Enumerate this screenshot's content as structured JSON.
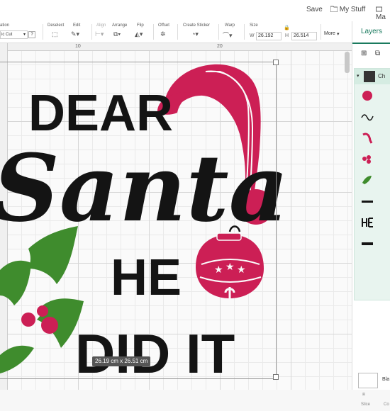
{
  "topbar": {
    "save": "Save",
    "my_stuff": "My Stuff",
    "ma": "Ma"
  },
  "toolbar": {
    "operation_label": "ation",
    "operation_value": "ic Cut",
    "deselect": "Deselect",
    "edit": "Edit",
    "align": "Align",
    "arrange": "Arrange",
    "flip": "Flip",
    "offset": "Offset",
    "create_sticker": "Create Sticker",
    "warp": "Warp",
    "size": "Size",
    "w_label": "W",
    "w_value": "26.192",
    "h_label": "H",
    "h_value": "26.514",
    "more": "More",
    "help": "?"
  },
  "ruler": {
    "ten": "10",
    "twenty": "20"
  },
  "canvas": {
    "dimensions": "26.19 cm x 26.51 cm",
    "design": {
      "line1": "DEAR",
      "line2": "Santa",
      "line3": "HE",
      "line4": "DID IT"
    }
  },
  "panel": {
    "tab": "Layers",
    "group_label": "Ch",
    "layers": [
      "bell-icon",
      "santa-script",
      "hat-icon",
      "berries-icon",
      "holly-icon",
      "did-it-text",
      "he-text",
      "dear-text"
    ],
    "blank_label": "Bla",
    "slice": "Slice",
    "combine": "Co"
  },
  "colors": {
    "red": "#cc1f55",
    "green": "#3f8c2d",
    "black": "#141414",
    "accent": "#1a7a5e"
  }
}
